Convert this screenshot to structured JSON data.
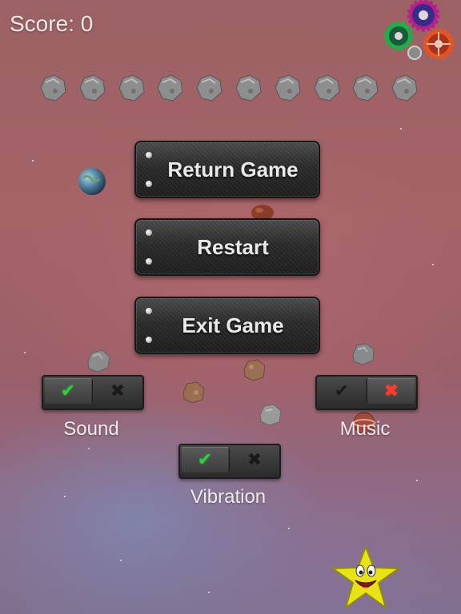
{
  "hud": {
    "score_label": "Score:",
    "score_value": "0"
  },
  "ammo": {
    "remaining": 10,
    "icon": "asteroid-icon"
  },
  "menu": {
    "return_label": "Return Game",
    "restart_label": "Restart",
    "exit_label": "Exit Game"
  },
  "settings": {
    "sound": {
      "label": "Sound",
      "enabled": true
    },
    "music": {
      "label": "Music",
      "enabled": false
    },
    "vibration": {
      "label": "Vibration",
      "enabled": true
    }
  },
  "icons": {
    "settings": "gears-icon",
    "mascot": "smiling-star-icon",
    "on": "check-icon",
    "off": "x-icon"
  },
  "colors": {
    "on_active": "#2fd23a",
    "off_active": "#ff3b2f",
    "button_face": "#2b2b2b",
    "text": "#e9e9e9"
  }
}
